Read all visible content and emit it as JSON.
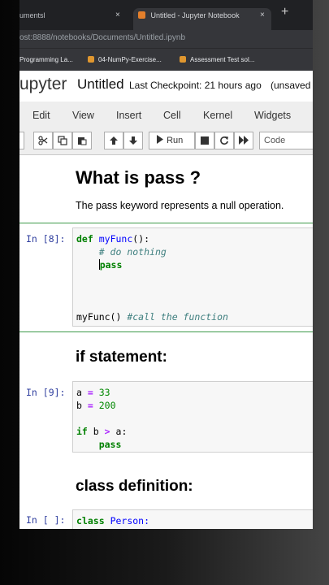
{
  "browser": {
    "tabs": [
      {
        "label": "umentsl",
        "close": "×"
      },
      {
        "label": "Untitled - Jupyter Notebook",
        "close": "×"
      }
    ],
    "new_tab": "+",
    "url": {
      "prefix": "ost",
      "rest": ":8888/notebooks/Documents/Untitled.ipynb"
    },
    "bookmarks": [
      {
        "label": "Programming La..."
      },
      {
        "label": "04-NumPy-Exercise..."
      },
      {
        "label": "Assessment Test sol..."
      }
    ]
  },
  "jupyter": {
    "logo": "upyter",
    "notebook_title": "Untitled",
    "checkpoint": "Last Checkpoint: 21 hours ago",
    "unsaved": "(unsaved"
  },
  "menu": [
    "Edit",
    "View",
    "Insert",
    "Cell",
    "Kernel",
    "Widgets"
  ],
  "toolbar": {
    "run_label": "Run",
    "cell_type": "Code"
  },
  "cells": {
    "md1_title": "What is pass ?",
    "md1_text": "The pass keyword represents a null operation.",
    "c1_prompt": "In [8]:",
    "c1_line1_kw": "def",
    "c1_line1_fn": "myFunc",
    "c1_line1_rest": "():",
    "c1_line2": "# do nothing",
    "c1_line3": "pass",
    "c1_line4_code": "myFunc() ",
    "c1_line4_comment": "#call the function",
    "md2_title": "if statement:",
    "c2_prompt": "In [9]:",
    "c2_line1_var": "a",
    "c2_line1_op": "=",
    "c2_line1_num": "33",
    "c2_line2_var": "b",
    "c2_line2_op": "=",
    "c2_line2_num": "200",
    "c2_line4_kw": "if",
    "c2_line4_a": "b",
    "c2_line4_op": ">",
    "c2_line4_b": "a:",
    "c2_line5": "pass",
    "md3_title": "class definition:",
    "c3_prompt": "In [ ]:",
    "c3_kw": "class",
    "c3_name": "Person:"
  }
}
